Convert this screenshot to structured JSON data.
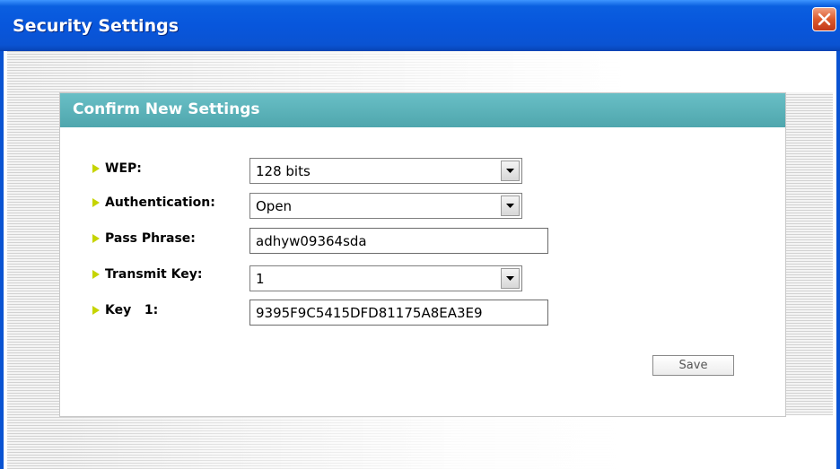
{
  "window": {
    "title": "Security Settings"
  },
  "panel": {
    "title": "Confirm New Settings"
  },
  "form": {
    "wep": {
      "label": "WEP:",
      "value": "128 bits"
    },
    "authentication": {
      "label": "Authentication:",
      "value": "Open"
    },
    "pass_phrase": {
      "label": "Pass Phrase:",
      "value": "adhyw09364sda"
    },
    "transmit_key": {
      "label": "Transmit Key:",
      "value": "1"
    },
    "key1": {
      "label": "Key   1:",
      "value": "9395F9C5415DFD81175A8EA3E9"
    }
  },
  "buttons": {
    "save": "Save"
  },
  "colors": {
    "titlebar": "#0856dc",
    "panel_header": "#5cb3b9",
    "bullet": "#c6d400"
  }
}
